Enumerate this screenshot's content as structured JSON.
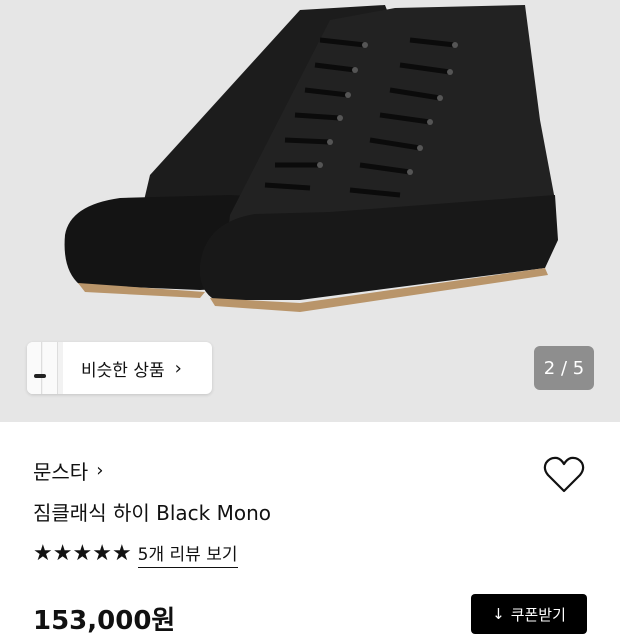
{
  "gallery": {
    "similar_label": "비슷한 상품",
    "chevron": "›",
    "counter": "2 / 5"
  },
  "product": {
    "brand": "문스타",
    "brand_chevron": "›",
    "title": "짐클래식 하이 Black Mono",
    "stars": [
      "★",
      "★",
      "★",
      "★",
      "★"
    ],
    "reviews_label": "5개 리뷰 보기",
    "price": "153,000원",
    "coupon_label": "쿠폰받기",
    "coupon_icon": "↓"
  },
  "colors": {
    "hero_bg": "#e6e6e6",
    "shoe": "#1a1a1a",
    "sole_line": "#b9956a",
    "counter_bg": "#8e8e8e"
  }
}
